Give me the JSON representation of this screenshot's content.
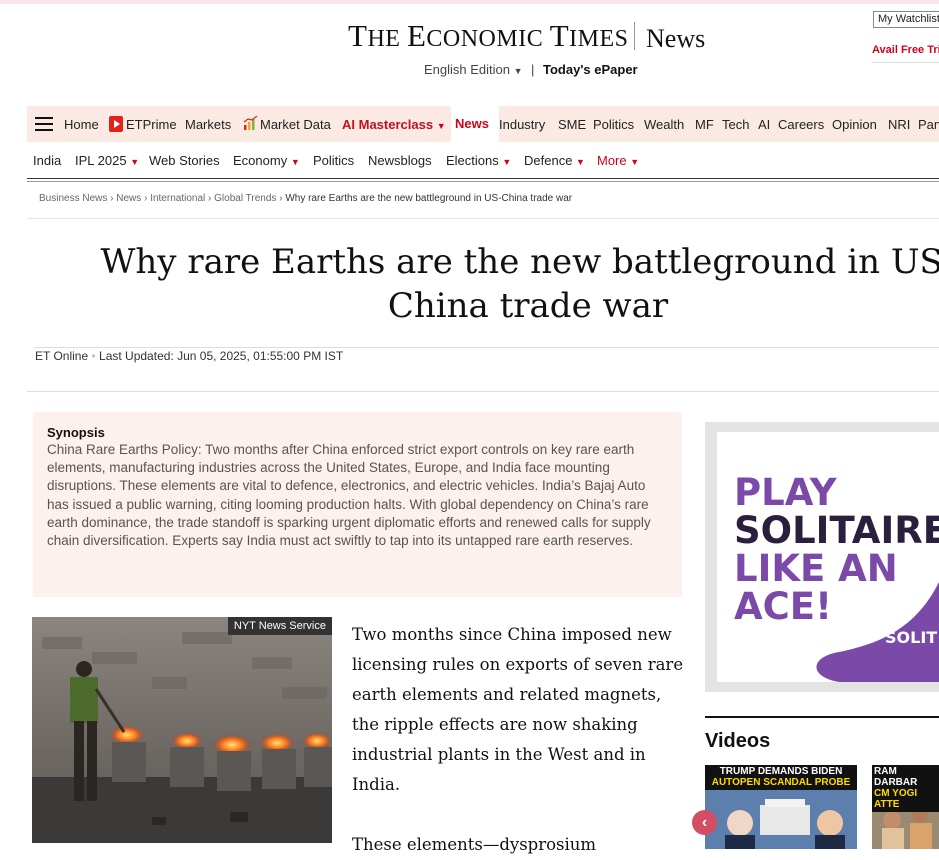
{
  "header": {
    "logo_text": "The Economic Times",
    "section_title": "News",
    "edition_label": "English Edition",
    "edition_separator": "|",
    "epaper_link": "Today's ePaper",
    "watchlist_label": "My Watchlist",
    "avail_label": "Avail Free Trial"
  },
  "nav_primary": {
    "items": [
      "Home",
      "ETPrime",
      "Markets",
      "Market Data",
      "AI Masterclass",
      "News",
      "Industry",
      "SME",
      "Politics",
      "Wealth",
      "MF",
      "Tech",
      "AI",
      "Careers",
      "Opinion",
      "NRI",
      "Panache"
    ],
    "active": "News",
    "highlight_color": "#d0021b"
  },
  "nav_secondary": {
    "items": [
      "India",
      "IPL 2025",
      "Web Stories",
      "Economy",
      "Politics",
      "Newsblogs",
      "Elections",
      "Defence",
      "More"
    ]
  },
  "breadcrumb": {
    "items": [
      "Business News",
      "News",
      "International",
      "Global Trends"
    ],
    "current": "Why rare Earths are the new battleground in US-China trade war",
    "separator": "›"
  },
  "article": {
    "headline": "Why rare Earths are the new battleground in US-China trade war",
    "author": "ET Online",
    "last_updated": "Last Updated: Jun 05, 2025, 01:55:00 PM IST",
    "synopsis_title": "Synopsis",
    "synopsis_text": "China Rare Earths Policy: Two months after China enforced strict export controls on key rare earth elements, manufacturing industries across the United States, Europe, and India face mounting disruptions. These elements are vital to defence, electronics, and electric vehicles. India’s Bajaj Auto has issued a public warning, citing looming production halts. With global dependency on China’s rare earth dominance, the trade standoff is sparking urgent diplomatic efforts and renewed calls for supply chain diversification. Experts say India must act swiftly to tap into its untapped rare earth reserves.",
    "image_credit": "NYT News Service",
    "body_paragraph_1": "Two months since China imposed new licensing rules on exports of seven rare earth elements and related magnets, the ripple effects are now shaking industrial plants in the West and in India.",
    "body_paragraph_2_start": "These elements—dysprosium"
  },
  "ad": {
    "lines": [
      "PLAY",
      "SOLITAIRE",
      "LIKE AN",
      "ACE!"
    ],
    "brand_fragment": "SOLIT",
    "color_purple": "#7b4aa8",
    "color_dark": "#2a1f3d"
  },
  "videos": {
    "title": "Videos",
    "cards": [
      {
        "caption_line1": "TRUMP DEMANDS BIDEN",
        "caption_line2": "AUTOPEN SCANDAL PROBE"
      },
      {
        "caption_line1": "RAM DARBAR",
        "caption_line2": "CM YOGI ATTE"
      }
    ],
    "prev_icon": "chevron-left-icon"
  }
}
